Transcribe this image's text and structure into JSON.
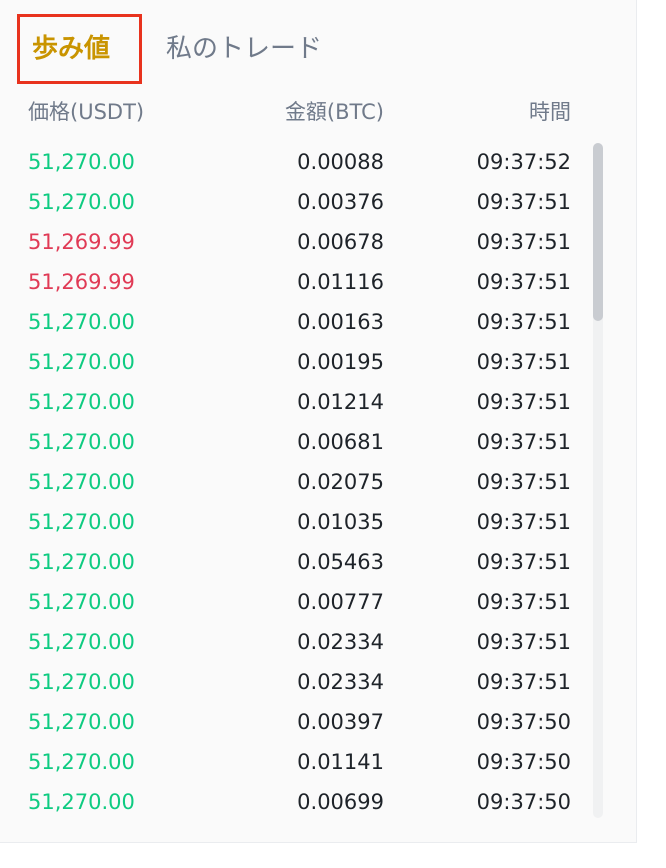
{
  "tabs": {
    "trades": "歩み値",
    "my_trades": "私のトレード"
  },
  "header": {
    "price": "価格(USDT)",
    "amount": "金額(BTC)",
    "time": "時間"
  },
  "colors": {
    "up": "#0ecb81",
    "down": "#e03a55",
    "active_tab": "#c99400",
    "highlight_box": "#e8321d"
  },
  "scrollbar": {
    "position": 0
  },
  "trades": [
    {
      "price": "51,270.00",
      "amount": "0.00088",
      "time": "09:37:52",
      "side": "up"
    },
    {
      "price": "51,270.00",
      "amount": "0.00376",
      "time": "09:37:51",
      "side": "up"
    },
    {
      "price": "51,269.99",
      "amount": "0.00678",
      "time": "09:37:51",
      "side": "down"
    },
    {
      "price": "51,269.99",
      "amount": "0.01116",
      "time": "09:37:51",
      "side": "down"
    },
    {
      "price": "51,270.00",
      "amount": "0.00163",
      "time": "09:37:51",
      "side": "up"
    },
    {
      "price": "51,270.00",
      "amount": "0.00195",
      "time": "09:37:51",
      "side": "up"
    },
    {
      "price": "51,270.00",
      "amount": "0.01214",
      "time": "09:37:51",
      "side": "up"
    },
    {
      "price": "51,270.00",
      "amount": "0.00681",
      "time": "09:37:51",
      "side": "up"
    },
    {
      "price": "51,270.00",
      "amount": "0.02075",
      "time": "09:37:51",
      "side": "up"
    },
    {
      "price": "51,270.00",
      "amount": "0.01035",
      "time": "09:37:51",
      "side": "up"
    },
    {
      "price": "51,270.00",
      "amount": "0.05463",
      "time": "09:37:51",
      "side": "up"
    },
    {
      "price": "51,270.00",
      "amount": "0.00777",
      "time": "09:37:51",
      "side": "up"
    },
    {
      "price": "51,270.00",
      "amount": "0.02334",
      "time": "09:37:51",
      "side": "up"
    },
    {
      "price": "51,270.00",
      "amount": "0.02334",
      "time": "09:37:51",
      "side": "up"
    },
    {
      "price": "51,270.00",
      "amount": "0.00397",
      "time": "09:37:50",
      "side": "up"
    },
    {
      "price": "51,270.00",
      "amount": "0.01141",
      "time": "09:37:50",
      "side": "up"
    },
    {
      "price": "51,270.00",
      "amount": "0.00699",
      "time": "09:37:50",
      "side": "up"
    }
  ]
}
